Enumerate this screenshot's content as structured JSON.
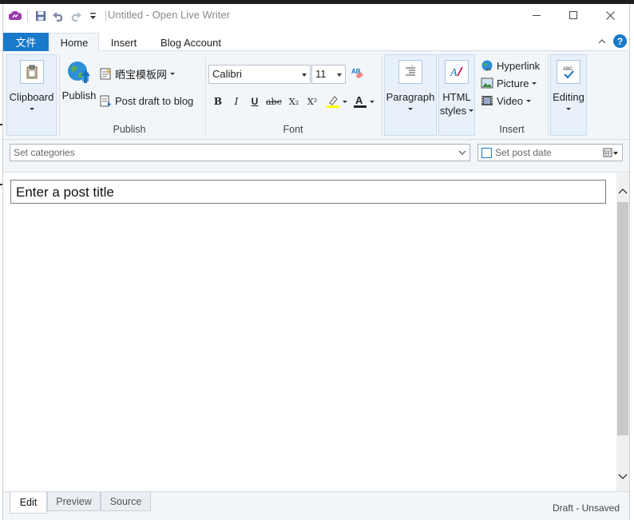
{
  "window": {
    "title": "Untitled - Open Live Writer",
    "minimize_icon": "minimize-icon",
    "maximize_icon": "maximize-icon",
    "close_icon": "close-icon"
  },
  "quick_access": {
    "items": [
      "app-logo-icon",
      "save-icon",
      "undo-icon",
      "redo-icon",
      "customize-dropdown-icon"
    ]
  },
  "tabs": {
    "file": "文件",
    "home": "Home",
    "insert": "Insert",
    "blog_account": "Blog Account",
    "active": "Home"
  },
  "ribbon": {
    "clipboard": {
      "label": "Clipboard",
      "icon": "clipboard-icon"
    },
    "publish": {
      "publish_label": "Publish",
      "blog_name": "晒宝模板网",
      "post_draft_label": "Post draft to blog",
      "group_label": "Publish"
    },
    "font": {
      "font_name": "Calibri",
      "font_size": "11",
      "group_label": "Font",
      "buttons": [
        "B",
        "I",
        "U",
        "abc",
        "X₂",
        "X²"
      ]
    },
    "paragraph": {
      "label": "Paragraph"
    },
    "html_styles": {
      "line1": "HTML",
      "line2": "styles"
    },
    "insert": {
      "hyperlink": "Hyperlink",
      "picture": "Picture",
      "video": "Video",
      "group_label": "Insert"
    },
    "editing": {
      "label": "Editing"
    }
  },
  "post": {
    "categories_placeholder": "Set categories",
    "post_date_label": "Set post date",
    "title_placeholder": "Enter a post title"
  },
  "view_tabs": {
    "edit": "Edit",
    "preview": "Preview",
    "source": "Source",
    "active": "Edit"
  },
  "status": {
    "text": "Draft - Unsaved"
  },
  "colors": {
    "accent": "#1979ca",
    "ribbon_bg": "#f3f6f9",
    "highlight_yellow": "#ffff00",
    "font_color_red": "#d00000"
  }
}
